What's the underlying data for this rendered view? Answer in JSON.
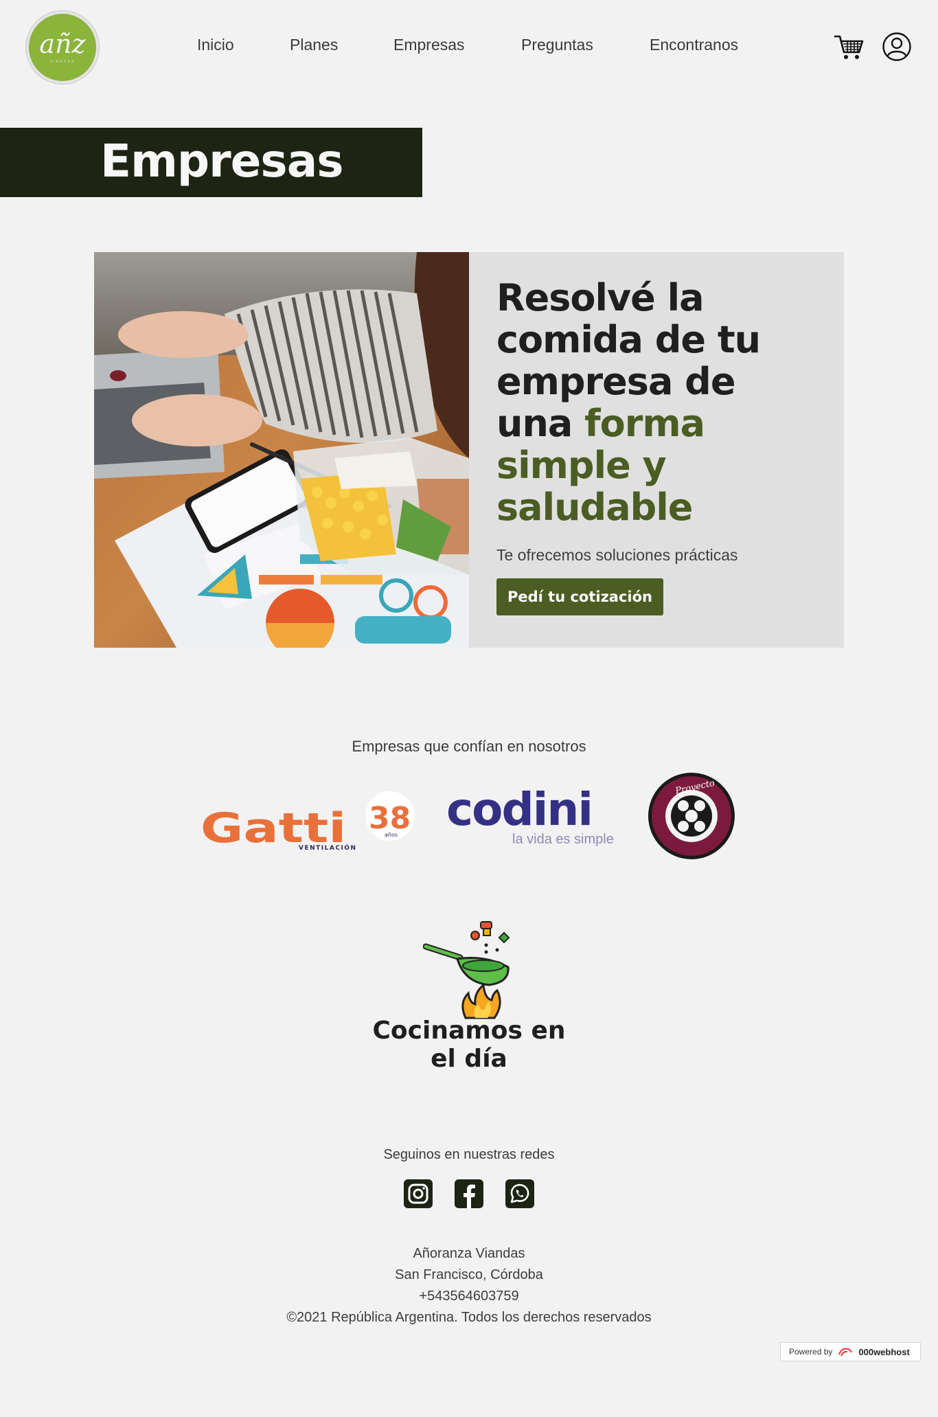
{
  "header": {
    "logo_text": "añz",
    "logo_sub": "VIANDAS",
    "nav": [
      {
        "label": "Inicio"
      },
      {
        "label": "Planes"
      },
      {
        "label": "Empresas"
      },
      {
        "label": "Preguntas"
      },
      {
        "label": "Encontranos"
      }
    ],
    "icons": [
      "cart-icon",
      "user-icon"
    ]
  },
  "page_title": "Empresas",
  "hero": {
    "title_plain": "Resolvé la comida de tu empresa de una ",
    "title_highlight": "forma simple y saludable",
    "subtitle": "Te ofrecemos soluciones prácticas",
    "cta_label": "Pedí tu cotización"
  },
  "companies": {
    "title": "Empresas que confían en nosotros",
    "logos": [
      {
        "name": "Gatti",
        "sub": "VENTILACIÓN",
        "badge": "38",
        "badge_sub": "años"
      },
      {
        "name": "codini",
        "tagline": "la vida es simple"
      },
      {
        "name": "Proyecto CC"
      }
    ]
  },
  "cooking": {
    "title": "Cocinamos en el día"
  },
  "footer": {
    "social_title": "Seguinos en nuestras redes",
    "social": [
      "instagram-icon",
      "facebook-icon",
      "whatsapp-icon"
    ],
    "lines": [
      "Añoranza Viandas",
      "San Francisco, Córdoba",
      "+543564603759",
      "©2021 República Argentina. Todos los derechos reservados"
    ],
    "powered_prefix": "Powered by",
    "powered_brand": "000webhost"
  },
  "colors": {
    "background": "#f2f2f2",
    "title_band": "#1d2414",
    "accent_green": "#4b5d23",
    "logo_green": "#8ab43a",
    "hero_panel": "#e0e0e0"
  }
}
